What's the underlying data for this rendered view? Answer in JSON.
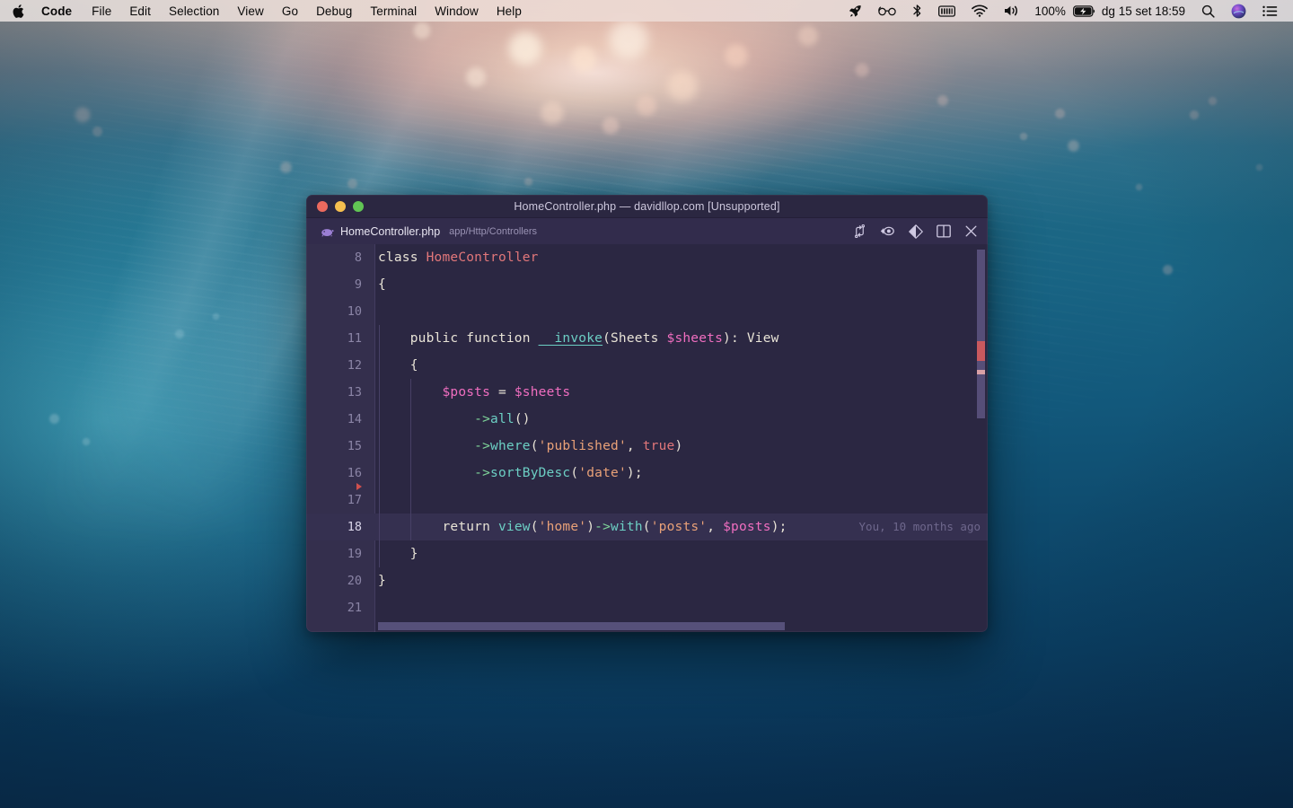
{
  "menubar": {
    "apple_icon": "apple-logo-icon",
    "app_name": "Code",
    "items": [
      "File",
      "Edit",
      "Selection",
      "View",
      "Go",
      "Debug",
      "Terminal",
      "Window",
      "Help"
    ],
    "status_icons": [
      "rocket-icon",
      "glasses-icon",
      "bluetooth-icon",
      "battery-module-icon",
      "wifi-icon",
      "volume-icon"
    ],
    "battery_percent": "100%",
    "battery_icon": "battery-charging-icon",
    "clock": "dg 15 set  18:59",
    "search_icon": "search-icon",
    "siri_icon": "siri-icon",
    "control_center_icon": "control-center-icon"
  },
  "window": {
    "title": "HomeController.php — davidllop.com [Unsupported]",
    "traffic_lights": [
      "close-button",
      "minimize-button",
      "zoom-button"
    ],
    "colors": {
      "close": "#ec6a5e",
      "minimize": "#f5bf4f",
      "zoom": "#61c554",
      "titlebar_bg": "#2b2741",
      "tabbar_bg": "#322c4c",
      "editor_bg": "#2b2742",
      "gutter_bg": "#342f4d",
      "active_line_bg": "#353050"
    }
  },
  "tab": {
    "icon": "php-elephant-icon",
    "filename": "HomeController.php",
    "path": "app/Http/Controllers",
    "actions": [
      {
        "name": "compare-changes-icon",
        "label": "Compare Changes"
      },
      {
        "name": "go-back-icon",
        "label": "Go Back"
      },
      {
        "name": "split-diff-icon",
        "label": "Split Diff"
      },
      {
        "name": "split-editor-icon",
        "label": "Split Editor"
      },
      {
        "name": "close-tab-icon",
        "label": "Close"
      }
    ]
  },
  "editor": {
    "active_line": 18,
    "blame": "You, 10 months ago",
    "gutter_marker_line": 16,
    "lines": [
      {
        "n": "8",
        "indent": 0,
        "tokens": [
          {
            "t": "class ",
            "c": "t-kw"
          },
          {
            "t": "HomeController",
            "c": "t-cls"
          }
        ]
      },
      {
        "n": "9",
        "indent": 0,
        "tokens": [
          {
            "t": "{",
            "c": "t-punc"
          }
        ]
      },
      {
        "n": "10",
        "indent": 0,
        "tokens": []
      },
      {
        "n": "11",
        "indent": 1,
        "tokens": [
          {
            "t": "    public function ",
            "c": "t-kw"
          },
          {
            "t": "__invoke",
            "c": "t-fn-u"
          },
          {
            "t": "(",
            "c": "t-punc"
          },
          {
            "t": "Sheets ",
            "c": "t-def"
          },
          {
            "t": "$sheets",
            "c": "t-var"
          },
          {
            "t": "): ",
            "c": "t-punc"
          },
          {
            "t": "View",
            "c": "t-def"
          }
        ]
      },
      {
        "n": "12",
        "indent": 1,
        "tokens": [
          {
            "t": "    {",
            "c": "t-punc"
          }
        ]
      },
      {
        "n": "13",
        "indent": 2,
        "tokens": [
          {
            "t": "        ",
            "c": "t-def"
          },
          {
            "t": "$posts",
            "c": "t-var"
          },
          {
            "t": " = ",
            "c": "t-punc"
          },
          {
            "t": "$sheets",
            "c": "t-var"
          }
        ]
      },
      {
        "n": "14",
        "indent": 2,
        "tokens": [
          {
            "t": "            ",
            "c": "t-def"
          },
          {
            "t": "->",
            "c": "t-arw"
          },
          {
            "t": "all",
            "c": "t-fn"
          },
          {
            "t": "()",
            "c": "t-punc"
          }
        ]
      },
      {
        "n": "15",
        "indent": 2,
        "tokens": [
          {
            "t": "            ",
            "c": "t-def"
          },
          {
            "t": "->",
            "c": "t-arw"
          },
          {
            "t": "where",
            "c": "t-fn"
          },
          {
            "t": "(",
            "c": "t-punc"
          },
          {
            "t": "'published'",
            "c": "t-str"
          },
          {
            "t": ", ",
            "c": "t-punc"
          },
          {
            "t": "true",
            "c": "t-cls"
          },
          {
            "t": ")",
            "c": "t-punc"
          }
        ]
      },
      {
        "n": "16",
        "indent": 2,
        "tokens": [
          {
            "t": "            ",
            "c": "t-def"
          },
          {
            "t": "->",
            "c": "t-arw"
          },
          {
            "t": "sortByDesc",
            "c": "t-fn"
          },
          {
            "t": "(",
            "c": "t-punc"
          },
          {
            "t": "'date'",
            "c": "t-str"
          },
          {
            "t": ");",
            "c": "t-punc"
          }
        ]
      },
      {
        "n": "17",
        "indent": 2,
        "tokens": []
      },
      {
        "n": "18",
        "indent": 2,
        "tokens": [
          {
            "t": "        ",
            "c": "t-def"
          },
          {
            "t": "return ",
            "c": "t-kw"
          },
          {
            "t": "view",
            "c": "t-fn"
          },
          {
            "t": "(",
            "c": "t-punc"
          },
          {
            "t": "'home'",
            "c": "t-str"
          },
          {
            "t": ")",
            "c": "t-punc"
          },
          {
            "t": "->",
            "c": "t-arw"
          },
          {
            "t": "with",
            "c": "t-fn"
          },
          {
            "t": "(",
            "c": "t-punc"
          },
          {
            "t": "'posts'",
            "c": "t-str"
          },
          {
            "t": ", ",
            "c": "t-punc"
          },
          {
            "t": "$posts",
            "c": "t-var"
          },
          {
            "t": ");",
            "c": "t-punc"
          }
        ]
      },
      {
        "n": "19",
        "indent": 1,
        "tokens": [
          {
            "t": "    }",
            "c": "t-punc"
          }
        ]
      },
      {
        "n": "20",
        "indent": 0,
        "tokens": [
          {
            "t": "}",
            "c": "t-punc"
          }
        ]
      },
      {
        "n": "21",
        "indent": 0,
        "tokens": []
      }
    ],
    "syntax_colors": {
      "default": "#e8e3d6",
      "class": "#e2777a",
      "function": "#6ccfc4",
      "variable": "#f06ec0",
      "string": "#e9a178",
      "arrow": "#7fd69a",
      "linenumber": "#8b85a6",
      "blame": "#6e678c"
    }
  }
}
